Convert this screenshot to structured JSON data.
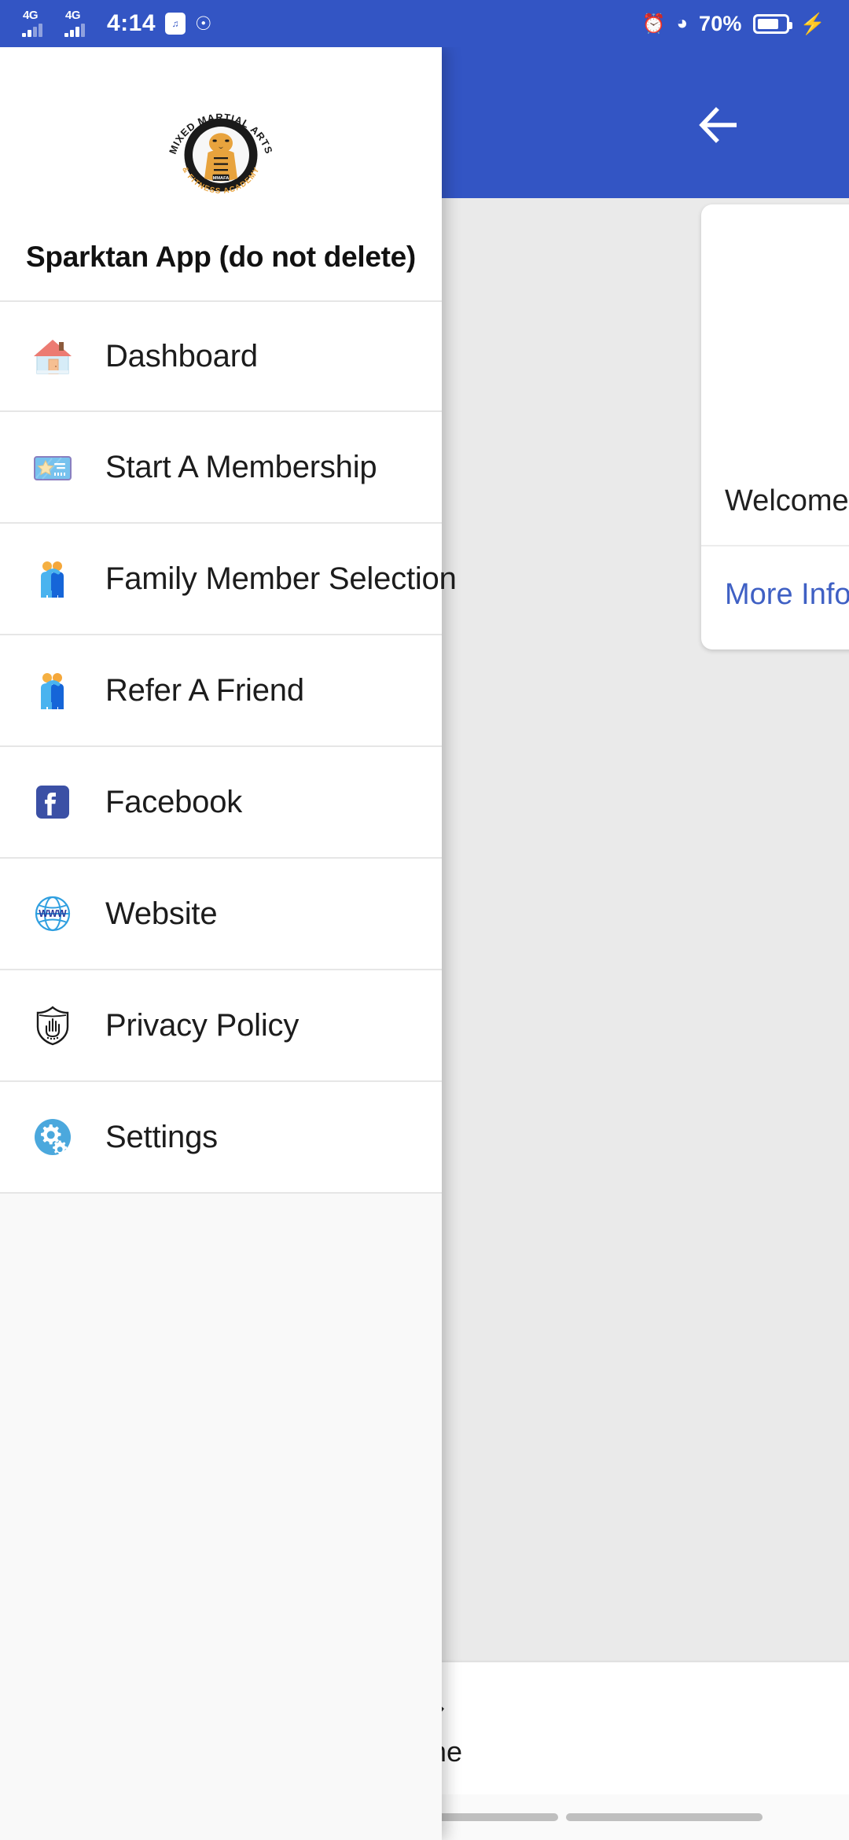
{
  "status_bar": {
    "network_1": "4G",
    "network_2": "4G",
    "time": "4:14",
    "badge_icon": "vibrate-mode-icon",
    "usb_icon": "usb-icon",
    "alarm_icon": "alarm-icon",
    "wifi_icon": "wifi-icon",
    "battery_percent": "70%",
    "charging_icon": "charging-bolt-icon",
    "background_color": "#3355c4"
  },
  "app_bar": {
    "back_label": "back-arrow",
    "background_color": "#3355c4"
  },
  "drawer": {
    "title": "Sparktan App (do not delete)",
    "logo_alt": "Mixed Martial Arts & Fitness Academy",
    "logo_text": {
      "top_arc": "MIXED MARTIAL ARTS",
      "bottom_arc": "& FITNESS ACADEMY",
      "center": "MMAFA"
    },
    "items": [
      {
        "label": "Dashboard",
        "icon": "house-icon"
      },
      {
        "label": "Start A Membership",
        "icon": "ticket-icon"
      },
      {
        "label": "Family Member Selection",
        "icon": "two-people-icon"
      },
      {
        "label": "Refer A Friend",
        "icon": "two-people-icon"
      },
      {
        "label": "Facebook",
        "icon": "facebook-icon"
      },
      {
        "label": "Website",
        "icon": "www-globe-icon"
      },
      {
        "label": "Privacy Policy",
        "icon": "shield-hand-icon"
      },
      {
        "label": "Settings",
        "icon": "gears-icon"
      }
    ]
  },
  "card": {
    "welcome_text": "Welcome",
    "more_info_label": "More Info",
    "link_color": "#3f60c4"
  },
  "bottom_nav": {
    "items": [
      {
        "label": "Home",
        "icon": "home-icon"
      }
    ]
  },
  "gesture_bar": {
    "segments": 3
  }
}
